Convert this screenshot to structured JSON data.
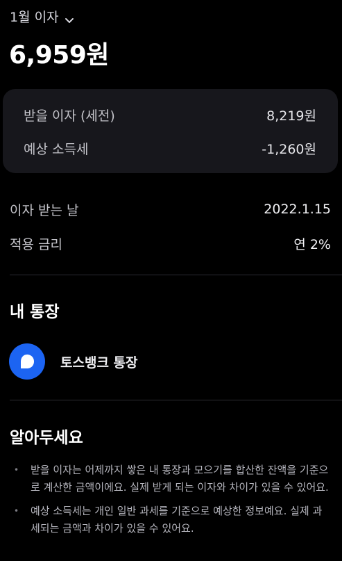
{
  "header": {
    "month_label": "1월 이자",
    "total_amount": "6,959원"
  },
  "summary": {
    "rows": [
      {
        "label": "받을 이자 (세전)",
        "value": "8,219원"
      },
      {
        "label": "예상 소득세",
        "value": "-1,260원"
      }
    ]
  },
  "details": {
    "rows": [
      {
        "label": "이자 받는 날",
        "value": "2022.1.15"
      },
      {
        "label": "적용 금리",
        "value": "연 2%"
      }
    ]
  },
  "account_section": {
    "title": "내 통장",
    "account_name": "토스뱅크 통장",
    "logo_color": "#1c64f2"
  },
  "notice_section": {
    "title": "알아두세요",
    "bullet": "•",
    "notes": [
      "받을 이자는 어제까지 쌓은 내 통장과 모으기를 합산한 잔액을 기준으로 계산한 금액이에요. 실제 받게 되는 이자와 차이가 있을 수 있어요.",
      "예상 소득세는 개인 일반 과세를 기준으로 예상한 정보예요. 실제 과세되는 금액과 차이가 있을 수 있어요."
    ]
  },
  "icons": {
    "month_dropdown": "chevron-down-icon",
    "account_logo": "toss-bank-logo-icon"
  },
  "colors": {
    "background": "#000000",
    "card_background": "#17171c",
    "accent_blue": "#1c64f2"
  }
}
